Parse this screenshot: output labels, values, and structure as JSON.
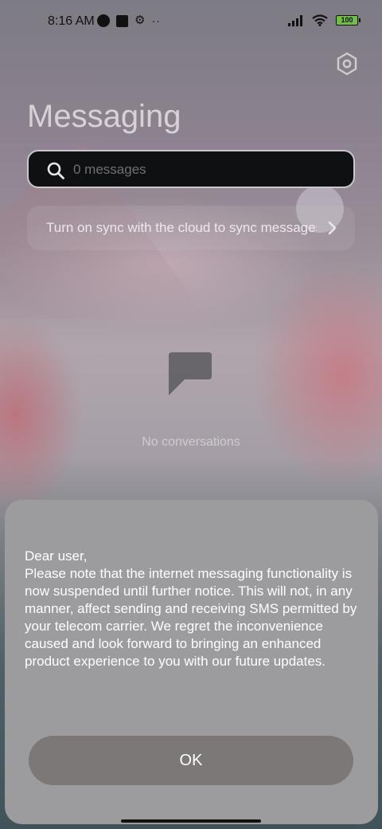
{
  "status_bar": {
    "time": "8:16 AM",
    "battery": "100",
    "icons": [
      "data-saver-icon",
      "square-app-icon",
      "gear-icon",
      "dots-icon",
      "signal-icon",
      "wifi-icon",
      "battery-icon"
    ]
  },
  "header": {
    "title": "Messaging",
    "settings_icon": "settings-hexagon-icon"
  },
  "search": {
    "placeholder": "0 messages"
  },
  "sync_banner": {
    "text": "Turn on sync with the cloud to sync messages"
  },
  "empty_state": {
    "text": "No conversations"
  },
  "dialog": {
    "message": "Dear user,\nPlease note that the internet messaging functionality is now suspended until further notice. This will not, in any manner, affect sending and receiving SMS permitted by your telecom carrier. We regret the inconvenience caused and look forward to bringing an enhanced product experience to you with our future updates.",
    "ok_label": "OK"
  },
  "colors": {
    "dialog_bg": "#9c9b9d",
    "ok_button_bg": "#7b7877",
    "battery_fill": "#6fbf45"
  }
}
